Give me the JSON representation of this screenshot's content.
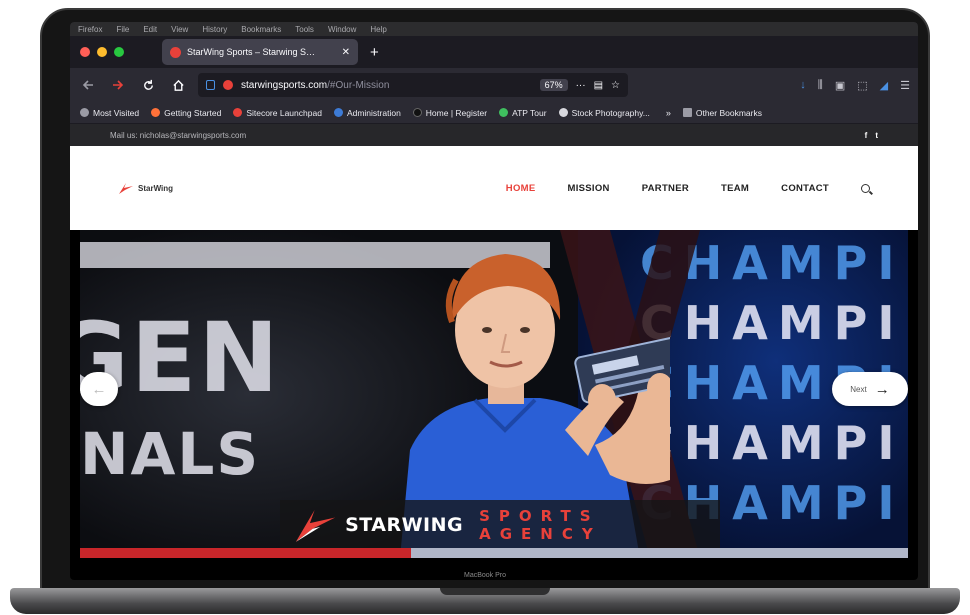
{
  "device": {
    "brand_label": "MacBook Pro"
  },
  "macos_menu": [
    "Firefox",
    "File",
    "Edit",
    "View",
    "History",
    "Bookmarks",
    "Tools",
    "Window",
    "Help"
  ],
  "browser": {
    "traffic_colors": {
      "close": "#ff5f57",
      "minimize": "#febc2e",
      "zoom": "#28c840"
    },
    "tab": {
      "title": "StarWing Sports – Starwing S…",
      "close_glyph": "✕"
    },
    "new_tab_glyph": "+",
    "url": {
      "domain": "starwingsports.com",
      "path": "/#Our-Mission"
    },
    "zoom_level": "67%",
    "bookmarks": [
      {
        "label": "Most Visited",
        "color": "#9b9ba5"
      },
      {
        "label": "Getting Started",
        "color": "#ff7139"
      },
      {
        "label": "Sitecore Launchpad",
        "color": "#e8413a"
      },
      {
        "label": "Administration",
        "color": "#3d7bd6"
      },
      {
        "label": "Home | Register",
        "color": "#1c1b22"
      },
      {
        "label": "ATP Tour",
        "color": "#3fbf5f"
      },
      {
        "label": "Stock Photography...",
        "color": "#d8d8de"
      }
    ],
    "bookmarks_more": "»",
    "bookmarks_other": "Other Bookmarks"
  },
  "site": {
    "topbar": {
      "email": "Mail us: nicholas@starwingsports.com",
      "social_facebook": "f",
      "social_twitter": "t"
    },
    "logo_text": "StarWing",
    "nav": [
      {
        "label": "HOME",
        "active": true
      },
      {
        "label": "MISSION",
        "active": false
      },
      {
        "label": "PARTNER",
        "active": false
      },
      {
        "label": "TEAM",
        "active": false
      },
      {
        "label": "CONTACT",
        "active": false
      }
    ],
    "hero": {
      "bg_word_1": "GEN",
      "bg_word_2": "NALS",
      "champ_word": "CHAMPI",
      "next_label": "Next",
      "banner_brand": "STARWING",
      "banner_tagline": "SPORTS AGENCY"
    }
  },
  "colors": {
    "accent": "#e8413a",
    "browser_dark": "#2b2a33"
  }
}
